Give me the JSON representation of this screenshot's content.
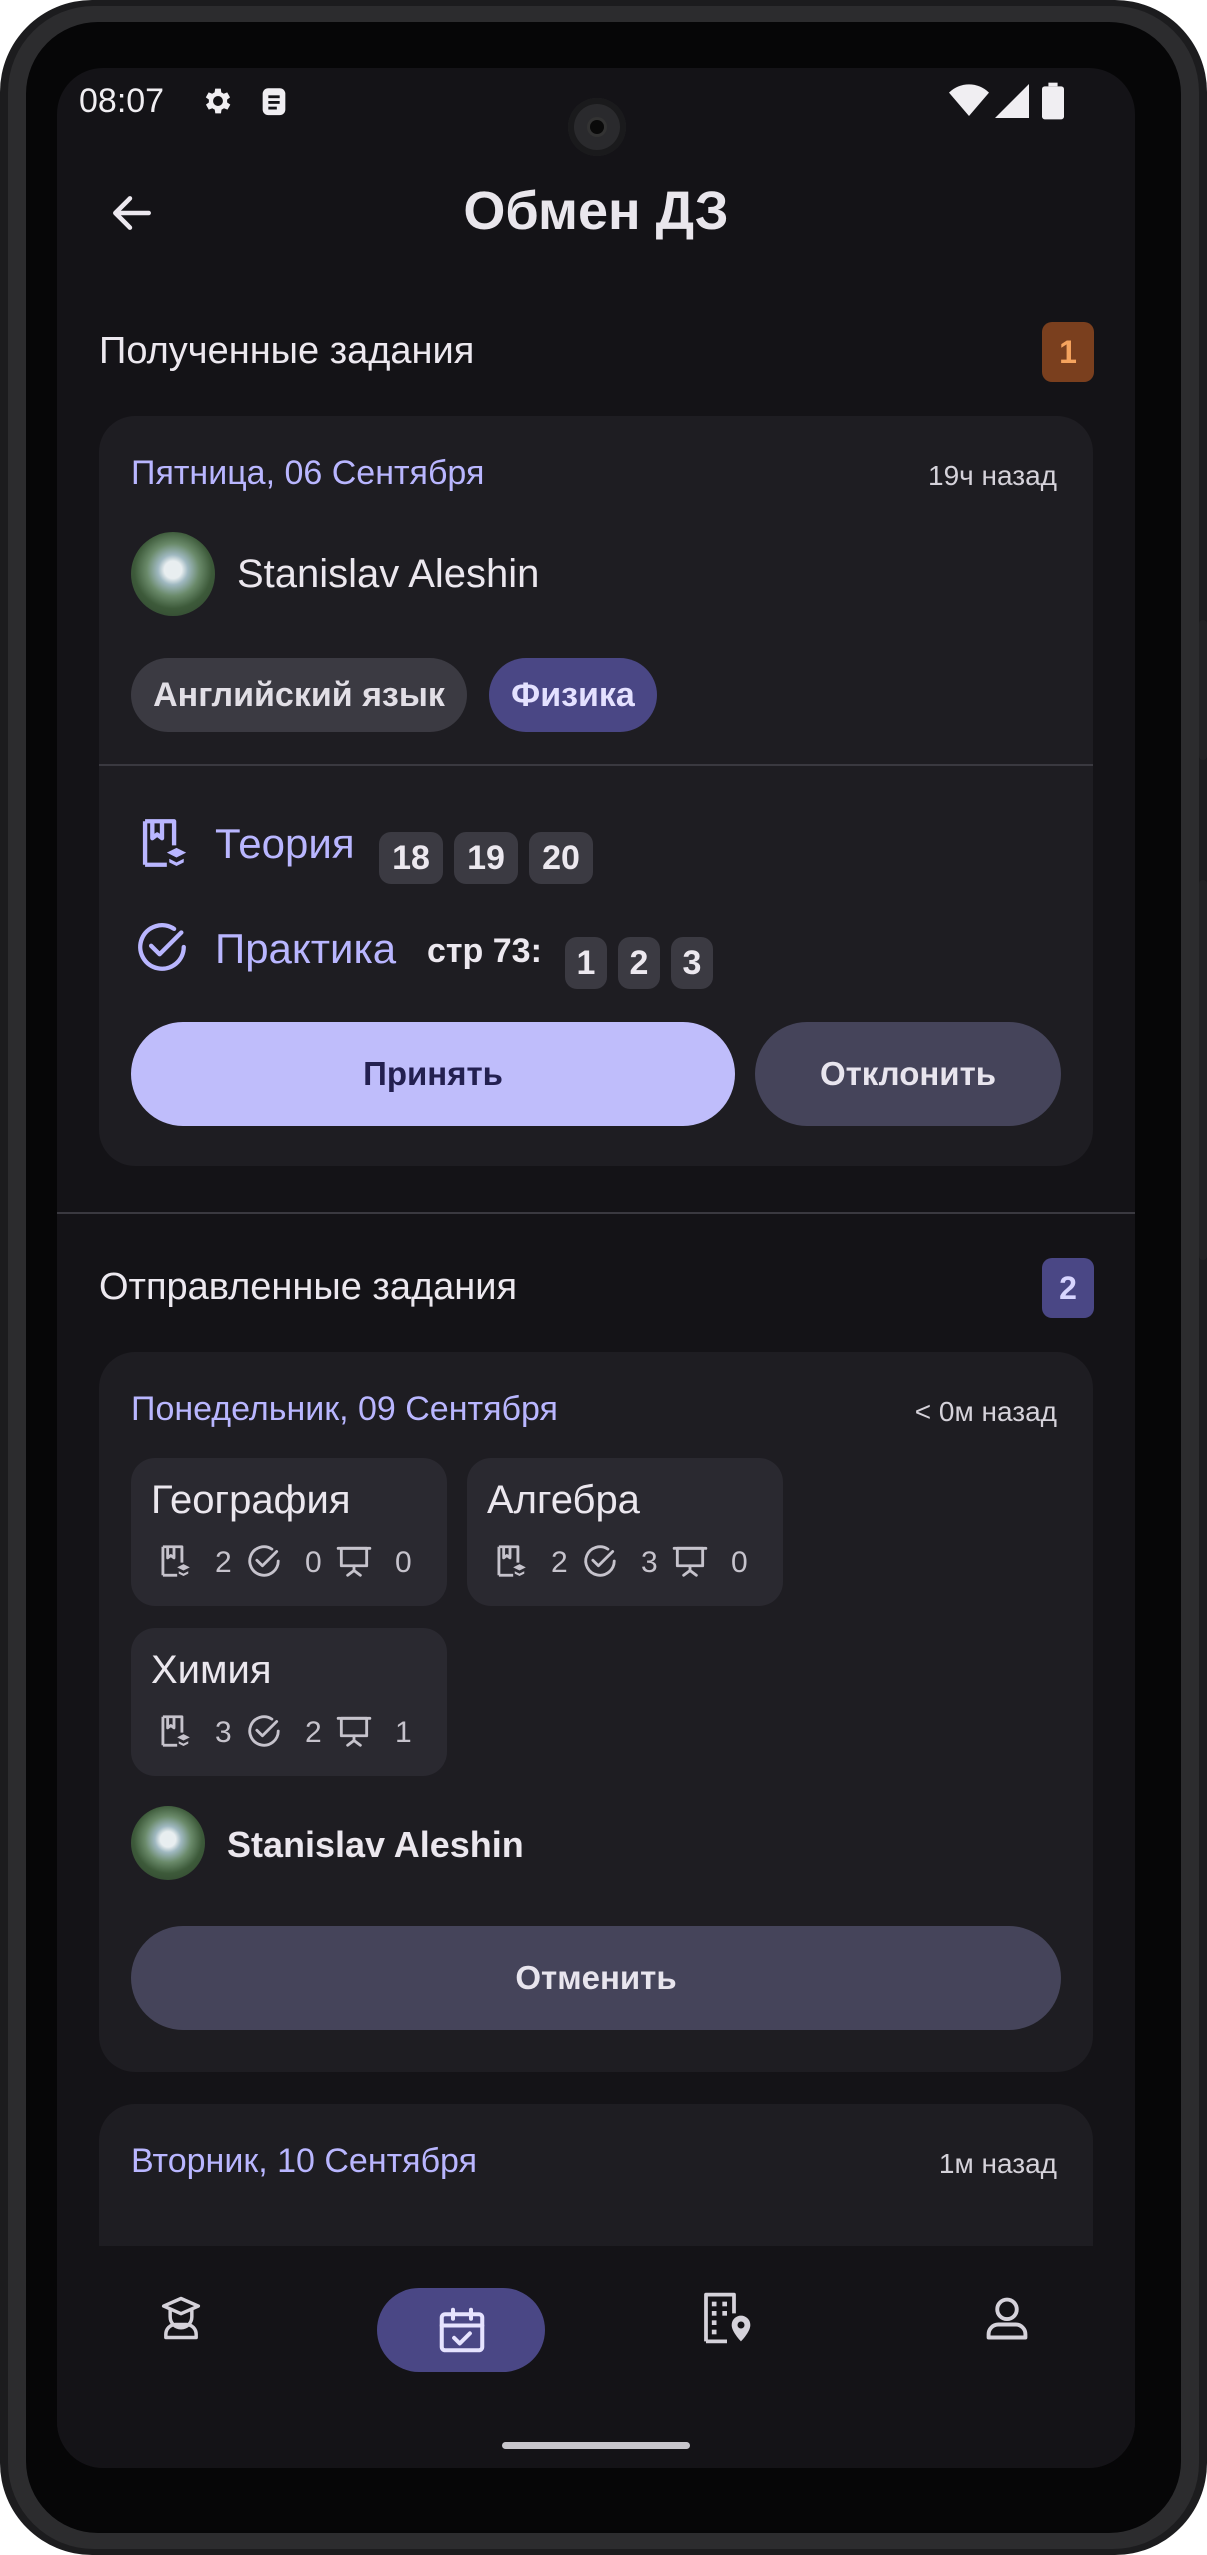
{
  "status_bar": {
    "time": "08:07",
    "left_icons": [
      "gear-icon",
      "clipboard-icon"
    ],
    "right_icons": [
      "wifi-icon",
      "signal-icon",
      "battery-icon"
    ]
  },
  "header": {
    "title": "Обмен ДЗ",
    "back_icon": "arrow-left-icon"
  },
  "received": {
    "title": "Полученные задания",
    "count": "1",
    "badge_color": "#7a3f1e",
    "card": {
      "date": "Пятница, 06 Сентября",
      "time_ago": "19ч назад",
      "sender": "Stanislav Aleshin",
      "subjects": [
        {
          "label": "Английский язык",
          "selected": false
        },
        {
          "label": "Физика",
          "selected": true
        }
      ],
      "theory": {
        "label": "Теория",
        "numbers": [
          "18",
          "19",
          "20"
        ]
      },
      "practice": {
        "label": "Практика",
        "page": "стр 73:",
        "numbers": [
          "1",
          "2",
          "3"
        ]
      },
      "accept_label": "Принять",
      "decline_label": "Отклонить"
    }
  },
  "sent": {
    "title": "Отправленные задания",
    "count": "2",
    "badge_color": "#4a4785",
    "card": {
      "date": "Понедельник, 09 Сентября",
      "time_ago": "< 0м назад",
      "subjects": [
        {
          "name": "География",
          "theory": "2",
          "practice": "0",
          "presentations": "0"
        },
        {
          "name": "Алгебра",
          "theory": "2",
          "practice": "3",
          "presentations": "0"
        },
        {
          "name": "Химия",
          "theory": "3",
          "practice": "2",
          "presentations": "1"
        }
      ],
      "receiver": "Stanislav Aleshin",
      "cancel_label": "Отменить"
    },
    "next_card": {
      "date": "Вторник, 10 Сентября",
      "time_ago": "1м назад"
    }
  },
  "bottom_nav": {
    "items": [
      "student-hat-icon",
      "calendar-check-icon",
      "building-location-icon",
      "person-icon"
    ],
    "active_index": 1
  },
  "colors": {
    "background": "#141317",
    "card": "#1e1d22",
    "accent": "#b9b6ff",
    "primary_button": "#bfbdfb",
    "secondary_button": "#45445a"
  }
}
